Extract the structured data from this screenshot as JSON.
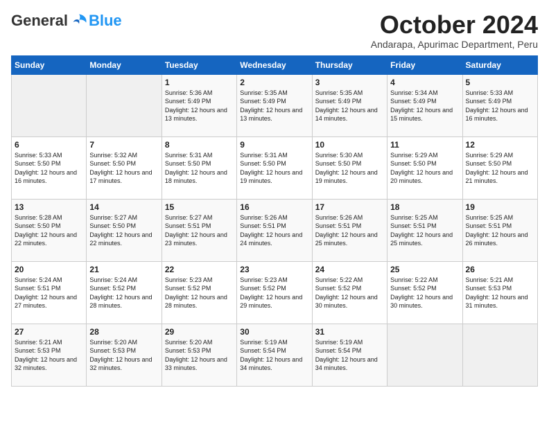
{
  "header": {
    "logo_general": "General",
    "logo_blue": "Blue",
    "month_title": "October 2024",
    "location": "Andarapa, Apurimac Department, Peru"
  },
  "days_of_week": [
    "Sunday",
    "Monday",
    "Tuesday",
    "Wednesday",
    "Thursday",
    "Friday",
    "Saturday"
  ],
  "weeks": [
    [
      {
        "day": "",
        "empty": true
      },
      {
        "day": "",
        "empty": true
      },
      {
        "day": "1",
        "sunrise": "5:36 AM",
        "sunset": "5:49 PM",
        "daylight": "12 hours and 13 minutes."
      },
      {
        "day": "2",
        "sunrise": "5:35 AM",
        "sunset": "5:49 PM",
        "daylight": "12 hours and 13 minutes."
      },
      {
        "day": "3",
        "sunrise": "5:35 AM",
        "sunset": "5:49 PM",
        "daylight": "12 hours and 14 minutes."
      },
      {
        "day": "4",
        "sunrise": "5:34 AM",
        "sunset": "5:49 PM",
        "daylight": "12 hours and 15 minutes."
      },
      {
        "day": "5",
        "sunrise": "5:33 AM",
        "sunset": "5:49 PM",
        "daylight": "12 hours and 16 minutes."
      }
    ],
    [
      {
        "day": "6",
        "sunrise": "5:33 AM",
        "sunset": "5:50 PM",
        "daylight": "12 hours and 16 minutes."
      },
      {
        "day": "7",
        "sunrise": "5:32 AM",
        "sunset": "5:50 PM",
        "daylight": "12 hours and 17 minutes."
      },
      {
        "day": "8",
        "sunrise": "5:31 AM",
        "sunset": "5:50 PM",
        "daylight": "12 hours and 18 minutes."
      },
      {
        "day": "9",
        "sunrise": "5:31 AM",
        "sunset": "5:50 PM",
        "daylight": "12 hours and 19 minutes."
      },
      {
        "day": "10",
        "sunrise": "5:30 AM",
        "sunset": "5:50 PM",
        "daylight": "12 hours and 19 minutes."
      },
      {
        "day": "11",
        "sunrise": "5:29 AM",
        "sunset": "5:50 PM",
        "daylight": "12 hours and 20 minutes."
      },
      {
        "day": "12",
        "sunrise": "5:29 AM",
        "sunset": "5:50 PM",
        "daylight": "12 hours and 21 minutes."
      }
    ],
    [
      {
        "day": "13",
        "sunrise": "5:28 AM",
        "sunset": "5:50 PM",
        "daylight": "12 hours and 22 minutes."
      },
      {
        "day": "14",
        "sunrise": "5:27 AM",
        "sunset": "5:50 PM",
        "daylight": "12 hours and 22 minutes."
      },
      {
        "day": "15",
        "sunrise": "5:27 AM",
        "sunset": "5:51 PM",
        "daylight": "12 hours and 23 minutes."
      },
      {
        "day": "16",
        "sunrise": "5:26 AM",
        "sunset": "5:51 PM",
        "daylight": "12 hours and 24 minutes."
      },
      {
        "day": "17",
        "sunrise": "5:26 AM",
        "sunset": "5:51 PM",
        "daylight": "12 hours and 25 minutes."
      },
      {
        "day": "18",
        "sunrise": "5:25 AM",
        "sunset": "5:51 PM",
        "daylight": "12 hours and 25 minutes."
      },
      {
        "day": "19",
        "sunrise": "5:25 AM",
        "sunset": "5:51 PM",
        "daylight": "12 hours and 26 minutes."
      }
    ],
    [
      {
        "day": "20",
        "sunrise": "5:24 AM",
        "sunset": "5:51 PM",
        "daylight": "12 hours and 27 minutes."
      },
      {
        "day": "21",
        "sunrise": "5:24 AM",
        "sunset": "5:52 PM",
        "daylight": "12 hours and 28 minutes."
      },
      {
        "day": "22",
        "sunrise": "5:23 AM",
        "sunset": "5:52 PM",
        "daylight": "12 hours and 28 minutes."
      },
      {
        "day": "23",
        "sunrise": "5:23 AM",
        "sunset": "5:52 PM",
        "daylight": "12 hours and 29 minutes."
      },
      {
        "day": "24",
        "sunrise": "5:22 AM",
        "sunset": "5:52 PM",
        "daylight": "12 hours and 30 minutes."
      },
      {
        "day": "25",
        "sunrise": "5:22 AM",
        "sunset": "5:52 PM",
        "daylight": "12 hours and 30 minutes."
      },
      {
        "day": "26",
        "sunrise": "5:21 AM",
        "sunset": "5:53 PM",
        "daylight": "12 hours and 31 minutes."
      }
    ],
    [
      {
        "day": "27",
        "sunrise": "5:21 AM",
        "sunset": "5:53 PM",
        "daylight": "12 hours and 32 minutes."
      },
      {
        "day": "28",
        "sunrise": "5:20 AM",
        "sunset": "5:53 PM",
        "daylight": "12 hours and 32 minutes."
      },
      {
        "day": "29",
        "sunrise": "5:20 AM",
        "sunset": "5:53 PM",
        "daylight": "12 hours and 33 minutes."
      },
      {
        "day": "30",
        "sunrise": "5:19 AM",
        "sunset": "5:54 PM",
        "daylight": "12 hours and 34 minutes."
      },
      {
        "day": "31",
        "sunrise": "5:19 AM",
        "sunset": "5:54 PM",
        "daylight": "12 hours and 34 minutes."
      },
      {
        "day": "",
        "empty": true
      },
      {
        "day": "",
        "empty": true
      }
    ]
  ]
}
